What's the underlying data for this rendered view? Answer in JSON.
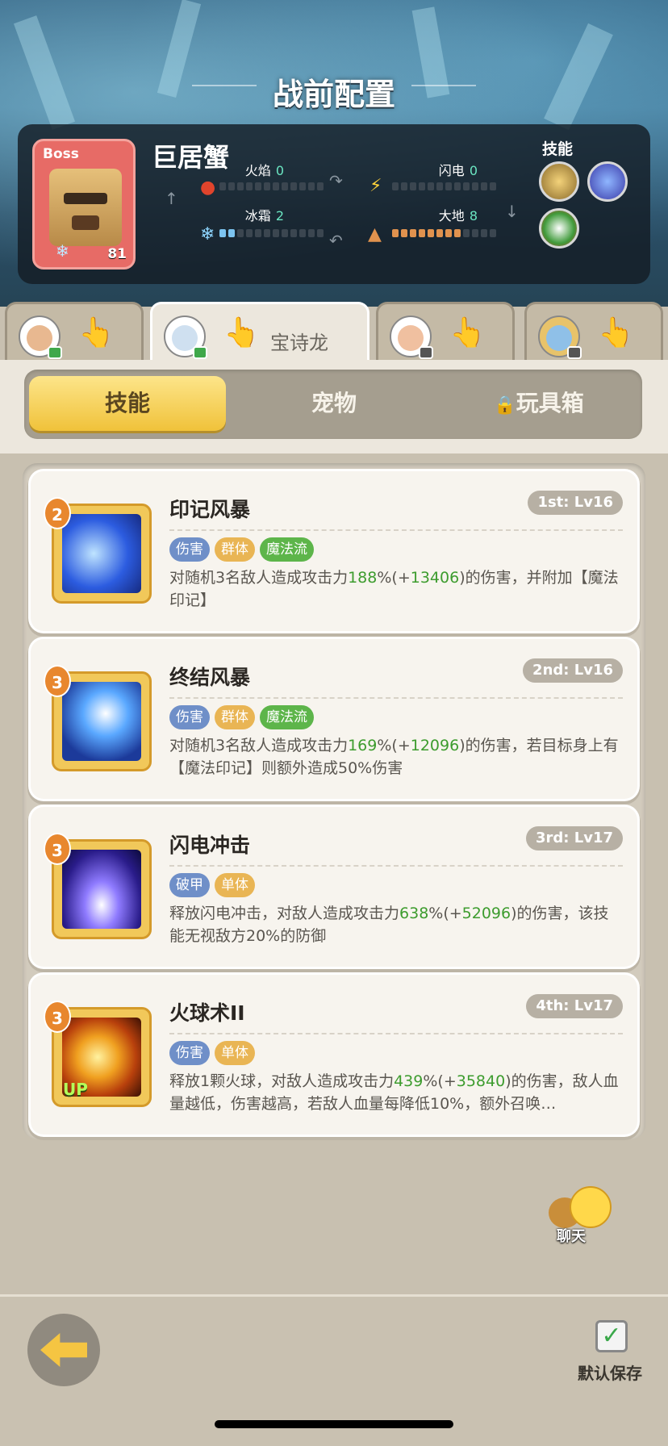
{
  "header": {
    "title": "战前配置"
  },
  "boss": {
    "badge": "Boss",
    "name": "巨居蟹",
    "level": "81",
    "elements": {
      "fire": {
        "label": "火焰",
        "value": "0",
        "fill": 0
      },
      "lightning": {
        "label": "闪电",
        "value": "0",
        "fill": 0
      },
      "frost": {
        "label": "冰霜",
        "value": "2",
        "fill": 2
      },
      "earth": {
        "label": "大地",
        "value": "8",
        "fill": 8
      }
    },
    "skills_label": "技能"
  },
  "hero_tabs": [
    {
      "name": "",
      "active": false
    },
    {
      "name": "宝诗龙",
      "active": true
    },
    {
      "name": "",
      "active": false
    },
    {
      "name": "",
      "active": false
    }
  ],
  "categories": [
    {
      "label": "技能",
      "active": true
    },
    {
      "label": "宠物",
      "active": false
    },
    {
      "label": "玩具箱",
      "active": false,
      "locked": true
    }
  ],
  "skills": [
    {
      "tier": "2",
      "name": "印记风暴",
      "slot": "1st: Lv16",
      "tags": [
        "伤害",
        "群体",
        "魔法流"
      ],
      "desc_pre": "对随机3名敌人造成攻击力",
      "pct": "188",
      "pct_suffix": "%(+",
      "bonus": "13406",
      "desc_post": ")的伤害，并附加【魔法印记】",
      "up": false
    },
    {
      "tier": "3",
      "name": "终结风暴",
      "slot": "2nd: Lv16",
      "tags": [
        "伤害",
        "群体",
        "魔法流"
      ],
      "desc_pre": "对随机3名敌人造成攻击力",
      "pct": "169",
      "pct_suffix": "%(+",
      "bonus": "12096",
      "desc_post": ")的伤害，若目标身上有【魔法印记】则额外造成50%伤害",
      "up": false
    },
    {
      "tier": "3",
      "name": "闪电冲击",
      "slot": "3rd: Lv17",
      "tags": [
        "破甲",
        "单体"
      ],
      "desc_pre": "释放闪电冲击，对敌人造成攻击力",
      "pct": "638",
      "pct_suffix": "%(+",
      "bonus": "52096",
      "desc_post": ")的伤害，该技能无视敌方20%的防御",
      "up": false
    },
    {
      "tier": "3",
      "name": "火球术II",
      "slot": "4th: Lv17",
      "tags": [
        "伤害",
        "单体"
      ],
      "desc_pre": "释放1颗火球，对敌人造成攻击力",
      "pct": "439",
      "pct_suffix": "%(+",
      "bonus": "35840",
      "desc_post": ")的伤害，敌人血量越低，伤害越高，若敌人血量每降低10%，额外召唤…",
      "up": true,
      "up_label": "UP"
    }
  ],
  "chat": {
    "label": "聊天"
  },
  "footer": {
    "save_label": "默认保存"
  },
  "colors": {
    "accent_gold": "#f0c23a",
    "tag_blue": "#6f8fc8",
    "tag_yellow": "#e9b554",
    "tag_green": "#5db54a",
    "highlight_green": "#3d9c2e"
  }
}
